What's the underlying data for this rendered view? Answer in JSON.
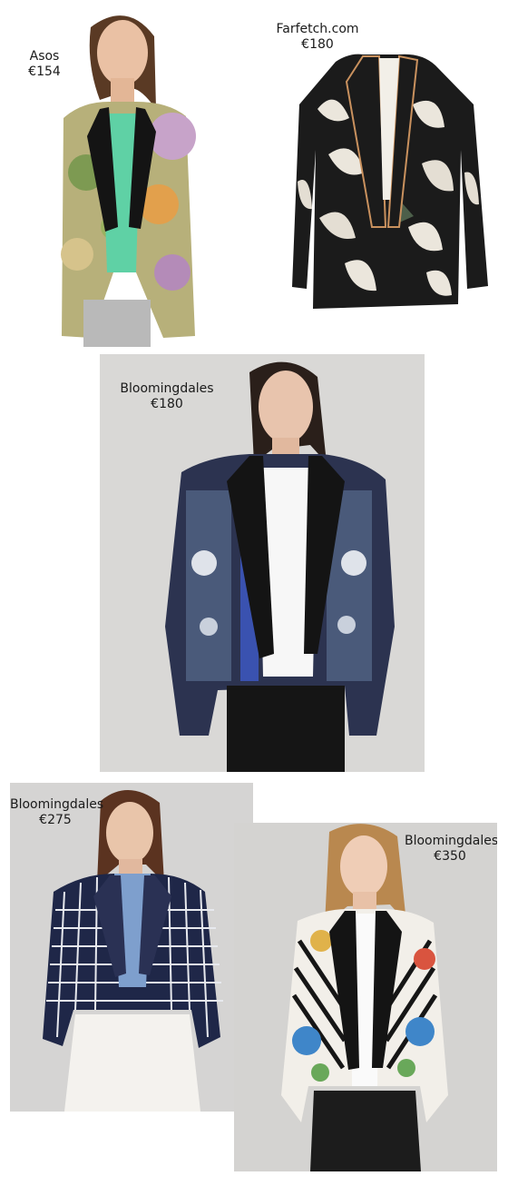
{
  "products": [
    {
      "store": "Asos",
      "price": "€154",
      "image": "woman-in-tropical-tiger-print-blazer"
    },
    {
      "store": "Farfetch.com",
      "price": "€180",
      "image": "black-white-leaf-print-blazer"
    },
    {
      "store": "Bloomingdales",
      "price": "€180",
      "image": "woman-in-navy-printed-blazer"
    },
    {
      "store": "Bloomingdales",
      "price": "€275",
      "image": "woman-in-grid-print-blazer"
    },
    {
      "store": "Bloomingdales",
      "price": "€350",
      "image": "woman-in-striped-floral-blazer"
    }
  ],
  "colors": {
    "background": "#ffffff",
    "photo_bg_grey": "#d9d8d6",
    "lapel_black": "#141414"
  }
}
